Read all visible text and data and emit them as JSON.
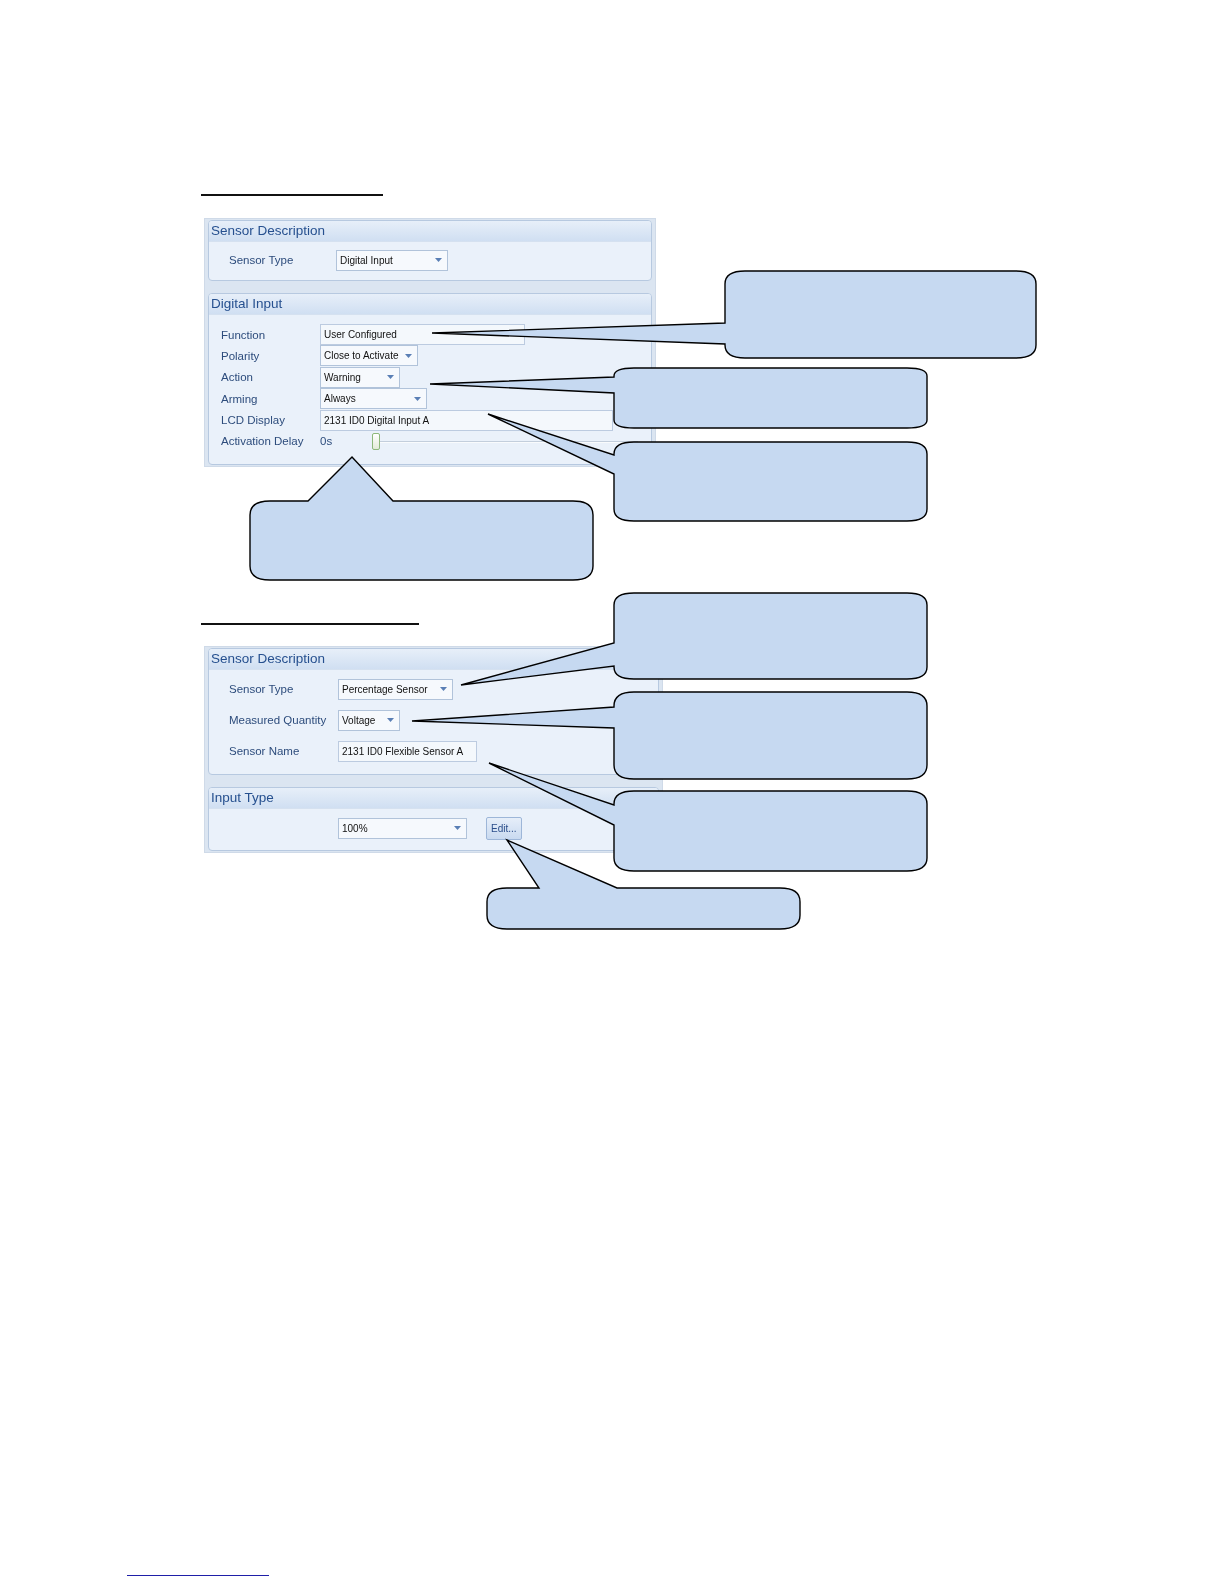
{
  "figures": [
    {
      "groups": [
        {
          "title": "Sensor Description",
          "rows": [
            {
              "label": "Sensor Type",
              "kind": "dropdown",
              "value": "Digital Input"
            }
          ]
        },
        {
          "title": "Digital Input",
          "rows": [
            {
              "label": "Function",
              "kind": "text",
              "value": "User Configured"
            },
            {
              "label": "Polarity",
              "kind": "dropdown",
              "value": "Close to Activate"
            },
            {
              "label": "Action",
              "kind": "dropdown",
              "value": "Warning"
            },
            {
              "label": "Arming",
              "kind": "dropdown",
              "value": "Always"
            },
            {
              "label": "LCD Display",
              "kind": "text",
              "value": "2131 ID0 Digital Input A"
            },
            {
              "label": "Activation Delay",
              "kind": "slider",
              "value": "0s",
              "level": 0
            }
          ]
        }
      ]
    },
    {
      "groups": [
        {
          "title": "Sensor Description",
          "rows": [
            {
              "label": "Sensor Type",
              "kind": "dropdown",
              "value": "Percentage Sensor"
            },
            {
              "label": "Measured Quantity",
              "kind": "dropdown",
              "value": "Voltage"
            },
            {
              "label": "Sensor Name",
              "kind": "text",
              "value": "2131 ID0 Flexible Sensor A"
            }
          ]
        },
        {
          "title": "Input Type",
          "rows": [
            {
              "kind": "dropdown",
              "value": "100%",
              "button": "Edit..."
            }
          ]
        }
      ]
    }
  ]
}
